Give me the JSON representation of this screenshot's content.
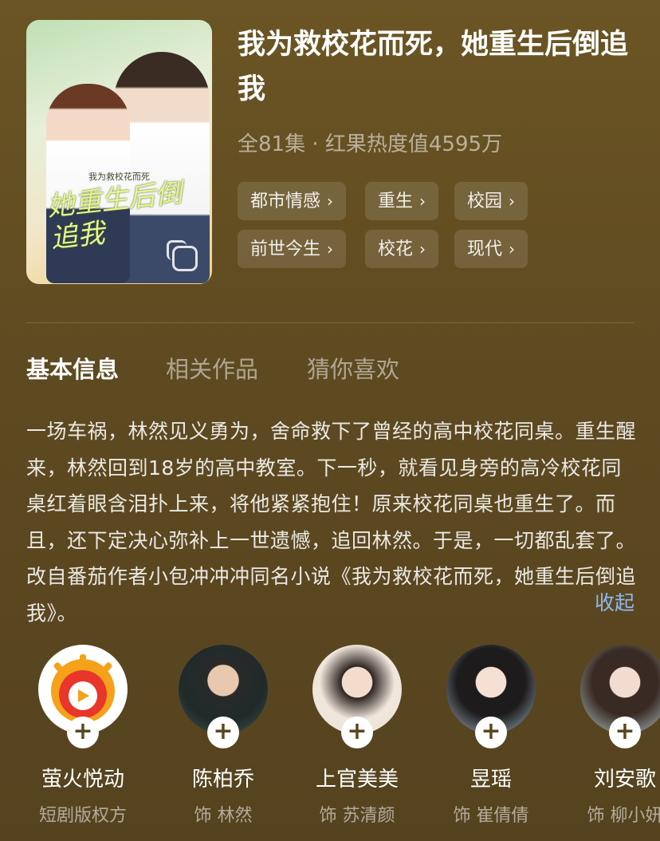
{
  "drama": {
    "title": "我为救校花而死，她重生后倒追我",
    "meta": "全81集 · 红果热度值4595万",
    "poster_art_title": "她重生后倒追我",
    "poster_art_sub": "我为救校花而死"
  },
  "tags": [
    {
      "label": "都市情感"
    },
    {
      "label": "重生"
    },
    {
      "label": "校园"
    },
    {
      "label": "前世今生"
    },
    {
      "label": "校花"
    },
    {
      "label": "现代"
    }
  ],
  "tabs": [
    {
      "label": "基本信息",
      "active": true
    },
    {
      "label": "相关作品",
      "active": false
    },
    {
      "label": "猜你喜欢",
      "active": false
    }
  ],
  "description": "一场车祸，林然见义勇为，舍命救下了曾经的高中校花同桌。重生醒来，林然回到18岁的高中教室。下一秒，就看见身旁的高冷校花同桌红着眼含泪扑上来，将他紧紧抱住！原来校花同桌也重生了。而且，还下定决心弥补上一世遗憾，追回林然。于是，一切都乱套了。改自番茄作者小包冲冲冲同名小说《我为救校花而死，她重生后倒追我》。",
  "collapse_label": "收起",
  "cast": [
    {
      "name": "萤火悦动",
      "role": "短剧版权方"
    },
    {
      "name": "陈柏乔",
      "role": "饰 林然"
    },
    {
      "name": "上官美美",
      "role": "饰 苏清颜"
    },
    {
      "name": "昱瑶",
      "role": "饰 崔倩倩"
    },
    {
      "name": "刘安歌",
      "role": "饰 柳小妍"
    }
  ],
  "colors": {
    "background": "#6b5524",
    "accent_link": "#8fb8ee",
    "logo_orange": "#f5a11a",
    "logo_red": "#e8362a"
  },
  "icons": {
    "chevron": "chevron-right-icon",
    "follow": "plus-icon",
    "poster_overlay": "copy-icon"
  }
}
